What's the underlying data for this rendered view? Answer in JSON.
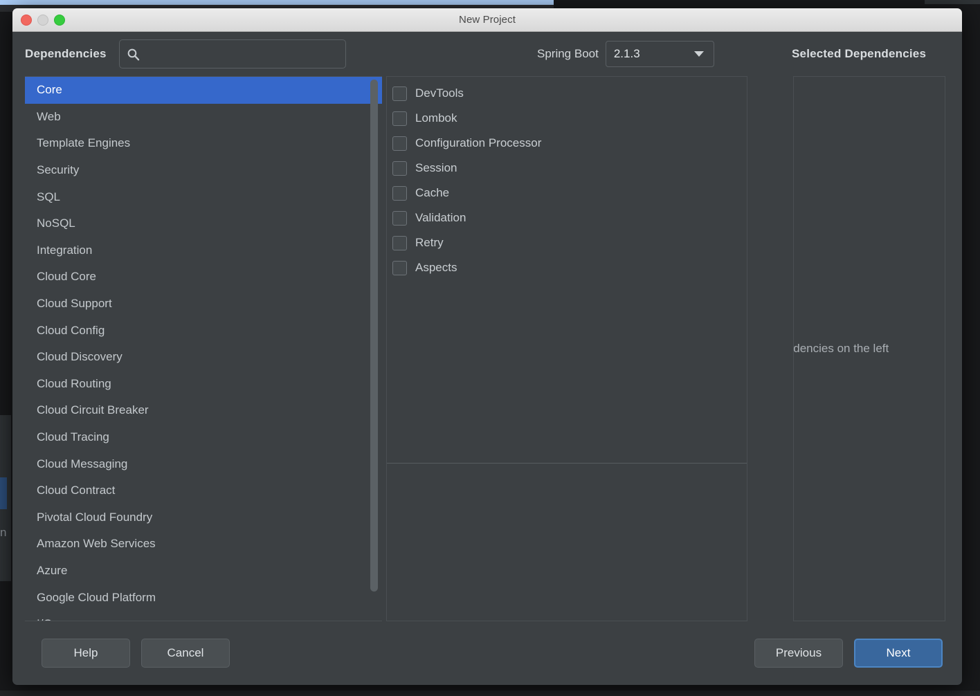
{
  "window": {
    "title": "New Project",
    "traffic_lights": [
      "close",
      "minimize",
      "maximize"
    ]
  },
  "header": {
    "dependencies_label": "Dependencies",
    "search": {
      "icon": "search-icon",
      "value": "",
      "placeholder": ""
    },
    "spring_boot_label": "Spring Boot",
    "spring_boot_version": "2.1.3",
    "spring_boot_caret": "chevron-down-icon",
    "selected_dependencies_title": "Selected Dependencies"
  },
  "categories": {
    "selected_index": 0,
    "items": [
      {
        "label": "Core"
      },
      {
        "label": "Web"
      },
      {
        "label": "Template Engines"
      },
      {
        "label": "Security"
      },
      {
        "label": "SQL"
      },
      {
        "label": "NoSQL"
      },
      {
        "label": "Integration"
      },
      {
        "label": "Cloud Core"
      },
      {
        "label": "Cloud Support"
      },
      {
        "label": "Cloud Config"
      },
      {
        "label": "Cloud Discovery"
      },
      {
        "label": "Cloud Routing"
      },
      {
        "label": "Cloud Circuit Breaker"
      },
      {
        "label": "Cloud Tracing"
      },
      {
        "label": "Cloud Messaging"
      },
      {
        "label": "Cloud Contract"
      },
      {
        "label": "Pivotal Cloud Foundry"
      },
      {
        "label": "Amazon Web Services"
      },
      {
        "label": "Azure"
      },
      {
        "label": "Google Cloud Platform"
      },
      {
        "label": "I/O"
      }
    ]
  },
  "dependencies": {
    "items": [
      {
        "label": "DevTools",
        "checked": false
      },
      {
        "label": "Lombok",
        "checked": false
      },
      {
        "label": "Configuration Processor",
        "checked": false
      },
      {
        "label": "Session",
        "checked": false
      },
      {
        "label": "Cache",
        "checked": false
      },
      {
        "label": "Validation",
        "checked": false
      },
      {
        "label": "Retry",
        "checked": false
      },
      {
        "label": "Aspects",
        "checked": false
      }
    ]
  },
  "selected_dependencies": {
    "empty_message": "Select dependencies on the left"
  },
  "footer": {
    "help_label": "Help",
    "cancel_label": "Cancel",
    "previous_label": "Previous",
    "next_label": "Next"
  },
  "background": {
    "ghost_text": "n"
  },
  "colors": {
    "panel_bg": "#3c4043",
    "selection_blue": "#3668cb",
    "primary_button": "#39679d",
    "primary_button_border": "#4d86c4",
    "titlebar_top": "#ececec",
    "titlebar_bottom": "#d8d8d8",
    "text_primary": "#d9dde0",
    "text_secondary": "#c4c9cd",
    "desktop_band_blue": "#aacdf7"
  }
}
